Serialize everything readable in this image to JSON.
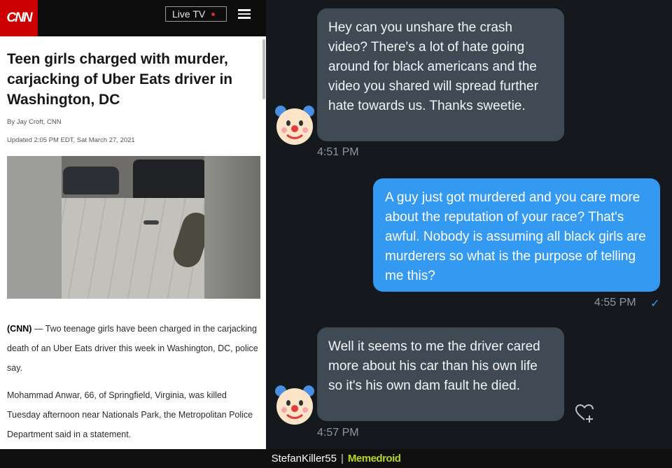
{
  "article": {
    "logo": "CNN",
    "live_label": "Live TV",
    "headline": "Teen girls charged with murder, carjacking of Uber Eats driver in Washington, DC",
    "byline": "By Jay Croft, CNN",
    "updated": "Updated 2:05 PM EDT, Sat March 27, 2021",
    "p1_lead": "(CNN)",
    "p1_rest": " — Two teenage girls have been charged in the carjacking death of an Uber Eats driver this week in Washington, DC, police say.",
    "p2": "Mohammad Anwar, 66, of Springfield, Virginia, was killed Tuesday afternoon near Nationals Park, the Metropolitan Police Department said in a statement."
  },
  "chat": {
    "messages": [
      {
        "text": "Hey can you unshare the crash video? There's a lot of hate going around for black americans and the video you shared will spread further hate towards us. Thanks sweetie.",
        "time": "4:51 PM"
      },
      {
        "text": "A guy just got murdered and you care more about the reputation of your race? That's awful. Nobody is assuming all black girls are murderers so what is the purpose of telling me this?",
        "time": "4:55 PM",
        "status": "✓"
      },
      {
        "text": "Well it seems to me the driver cared more about his car than his own life so it's his own dam fault he died.",
        "time": "4:57 PM"
      }
    ]
  },
  "footer": {
    "username": "StefanKiller55",
    "separator": "|",
    "brand": "Memedroid"
  },
  "colors": {
    "cnn_red": "#cc0000",
    "incoming_bubble": "#404a55",
    "outgoing_bubble": "#3499f0",
    "brand_green": "#b6d625"
  }
}
